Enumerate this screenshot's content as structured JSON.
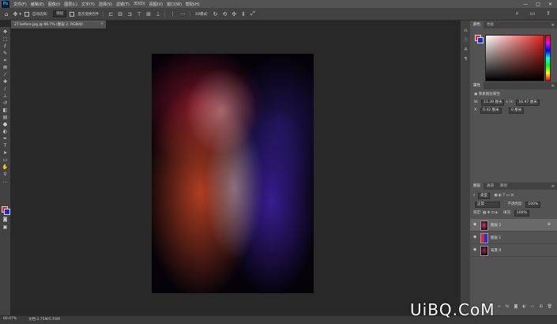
{
  "menubar": {
    "logo": "Ps",
    "items": [
      "文件(F)",
      "编辑(E)",
      "图像(I)",
      "图层(L)",
      "文字(Y)",
      "选择(S)",
      "滤镜(T)",
      "3D(D)",
      "视图(V)",
      "窗口(W)",
      "帮助(H)"
    ],
    "window_controls": [
      "—",
      "□",
      "✕"
    ]
  },
  "options_bar": {
    "auto_select_label": "自动选择：",
    "auto_select_value": "图层",
    "show_transform_label": "显示变换控件"
  },
  "document_tab": {
    "title": "27 before.jpg @ 66.7% (图层 2, RGB/8)",
    "close": "×"
  },
  "status_bar": {
    "zoom": "66.67%",
    "doc_info": "文档:2.75M/5.74M"
  },
  "color_panel": {
    "tabs": [
      "颜色",
      "色板"
    ],
    "fg_color": "#e0231c",
    "bg_color": "#1b2bd6"
  },
  "properties_panel": {
    "tabs": [
      "属性"
    ],
    "title": "像素图层属性",
    "w_label": "W:",
    "w_value": "11.39 厘米",
    "h_label": "H:",
    "h_value": "16.97 厘米",
    "x_label": "X:",
    "x_value": "0.42 厘米",
    "y_value": "0 厘米"
  },
  "layers_panel": {
    "tabs": [
      "图层",
      "通道",
      "路径"
    ],
    "filter_label": "类型",
    "blend_mode": "正常",
    "opacity_label": "不透明度:",
    "opacity_value": "100%",
    "lock_label": "锁定:",
    "fill_label": "填充:",
    "fill_value": "100%",
    "layers": [
      {
        "name": "图层 2",
        "selected": true,
        "fx": "⊕"
      },
      {
        "name": "图层 1",
        "selected": false,
        "fx": ""
      },
      {
        "name": "背景 0",
        "selected": false,
        "fx": ""
      }
    ],
    "bottom_icons": [
      "link-icon",
      "fx-icon",
      "mask-icon",
      "adjustment-icon",
      "folder-icon",
      "new-layer-icon",
      "trash-icon"
    ]
  },
  "watermark": "UiBQ.CoM"
}
